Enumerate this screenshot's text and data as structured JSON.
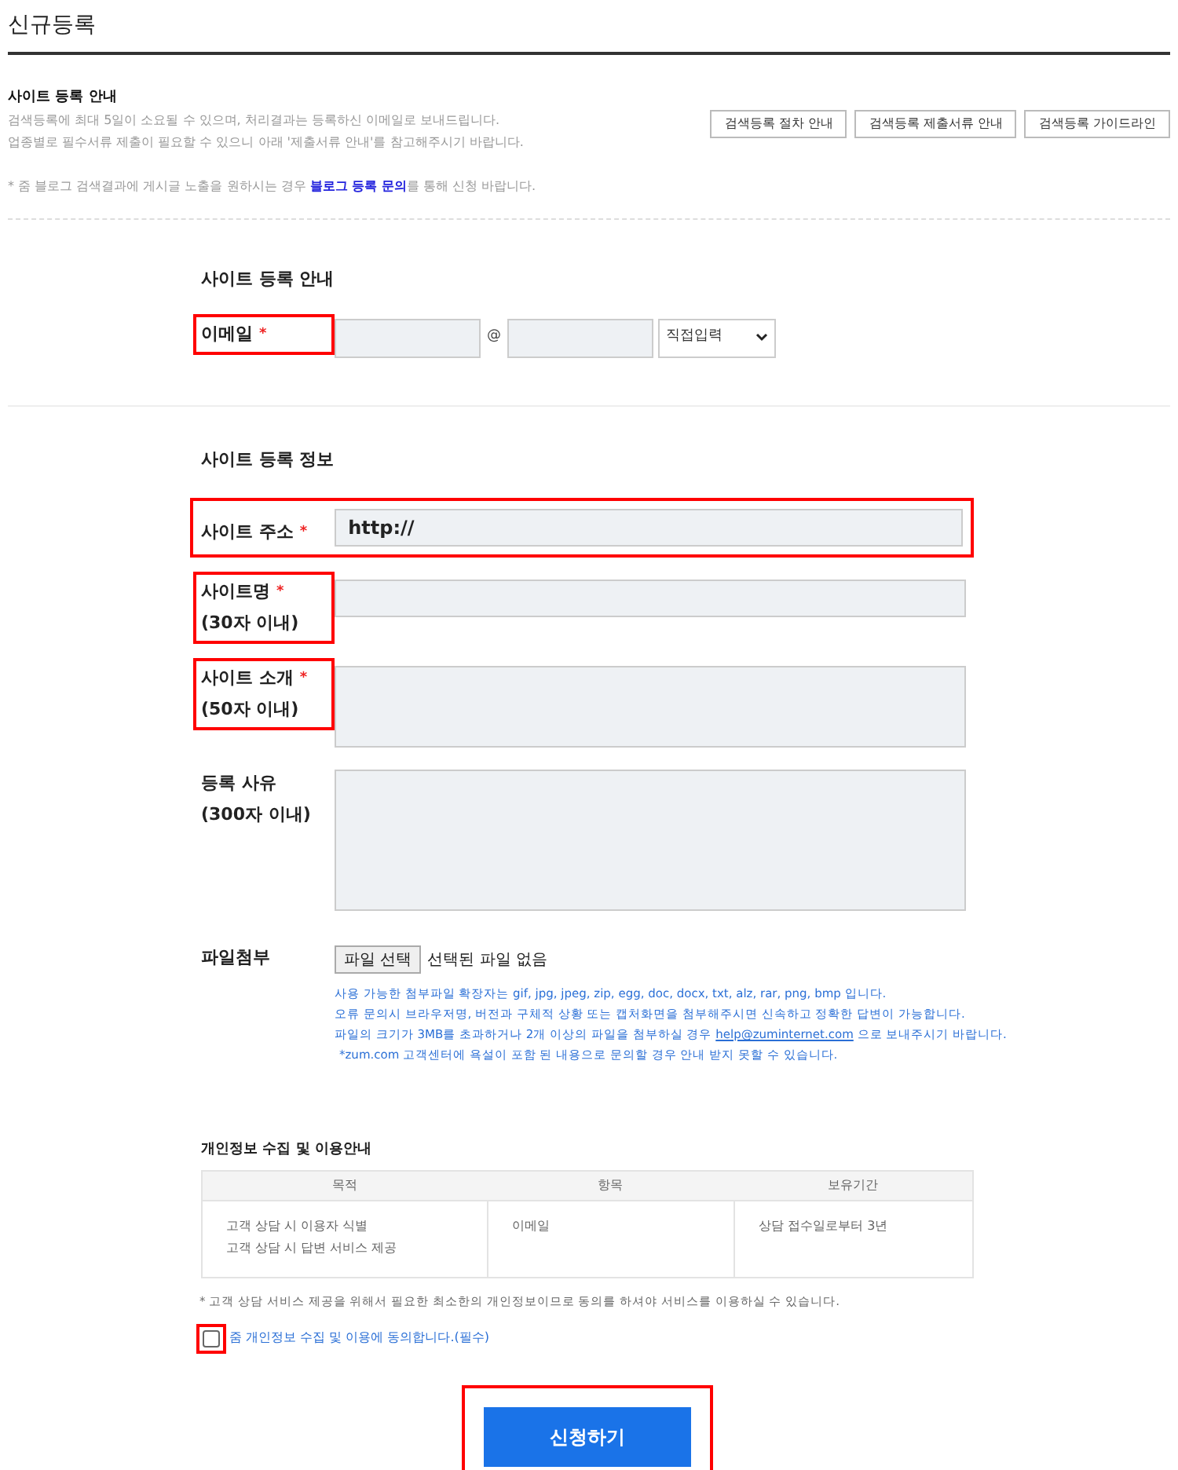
{
  "page_title": "신규등록",
  "notice": {
    "heading": "사이트 등록 안내",
    "lines": [
      "검색등록에 최대 5일이 소요될 수 있으며, 처리결과는 등록하신 이메일로 보내드립니다.",
      "업종별로 필수서류 제출이 필요할 수 있으니 아래 '제출서류 안내'를 참고해주시기 바랍니다."
    ],
    "note_before": "* 줌 블로그 검색결과에 게시글 노출을 원하시는 경우 ",
    "note_link": "블로그 등록 문의",
    "note_after": "를 통해 신청 바랍니다.",
    "buttons": [
      "검색등록 절차 안내",
      "검색등록 제출서류 안내",
      "검색등록 가이드라인"
    ]
  },
  "email_section": {
    "heading": "사이트 등록 안내",
    "label": "이메일",
    "required_mark": "*",
    "label_highlighted": true,
    "at": "@",
    "domain_select": "직접입력"
  },
  "info_section": {
    "heading": "사이트 등록 정보",
    "fields": [
      {
        "kind": "input",
        "label": "사이트 주소",
        "required_mark": "*",
        "label_highlighted": false,
        "row_highlighted": true,
        "value": "http://"
      },
      {
        "kind": "input",
        "label": "사이트명",
        "sub": "(30자 이내)",
        "required_mark": "*",
        "label_highlighted": true,
        "row_highlighted": false
      },
      {
        "kind": "textarea",
        "label": "사이트 소개",
        "sub": "(50자 이내)",
        "required_mark": "*",
        "label_highlighted": true,
        "row_highlighted": false
      },
      {
        "kind": "textarea_large",
        "label": "등록 사유",
        "sub": "(300자 이내)",
        "label_highlighted": false,
        "row_highlighted": false
      }
    ]
  },
  "file": {
    "label": "파일첨부",
    "button": "파일 선택",
    "status": "선택된 파일 없음",
    "help": [
      "사용 가능한 첨부파일 확장자는 gif, jpg, jpeg, zip, egg, doc, docx, txt, alz, rar, png, bmp 입니다.",
      "오류 문의시 브라우저명, 버전과 구체적 상황 또는 캡처화면을 첨부해주시면 신속하고 정확한 답변이 가능합니다."
    ],
    "size_before": "파일의 크기가 3MB를 초과하거나 2개 이상의 파일을 첨부하실 경우 ",
    "size_email": "help@zuminternet.com",
    "size_after": " 으로 보내주시기 바랍니다.",
    "warning": "*zum.com 고객센터에 욕설이 포함 된 내용으로 문의할 경우 안내 받지 못할 수 있습니다."
  },
  "privacy": {
    "heading": "개인정보 수집 및 이용안내",
    "columns": [
      "목적",
      "항목",
      "보유기간"
    ],
    "row": [
      [
        "고객 상담 시 이용자 식별",
        "고객 상담 시 답변 서비스 제공"
      ],
      [
        "이메일"
      ],
      [
        "상담 접수일로부터 3년"
      ]
    ],
    "note": "* 고객 상담 서비스 제공을 위해서 필요한 최소한의 개인정보이므로 동의를 하셔야 서비스를 이용하실 수 있습니다.",
    "agree": {
      "label": "줌 개인정보 수집 및 이용에 동의합니다.(필수)",
      "checked": false,
      "highlighted": true
    }
  },
  "submit": {
    "label": "신청하기",
    "highlighted": true
  }
}
